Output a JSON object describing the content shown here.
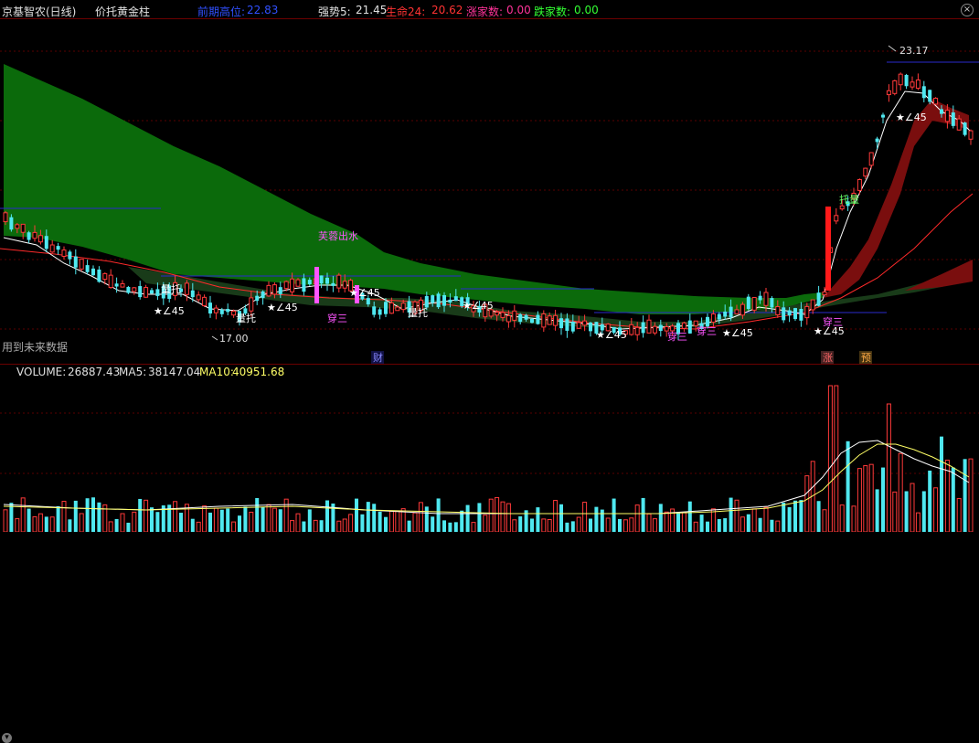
{
  "header": {
    "stock": "京基智农(日线)",
    "indicator": "价托黄金柱",
    "pressure_label": "前期高位:",
    "pressure_value": "22.83",
    "strong_label": "强势5:",
    "strong_value": "21.45",
    "life_label": "生命24:",
    "life_value": "20.62",
    "up_label": "涨家数:",
    "up_value": "0.00",
    "down_label": "跌家数:",
    "down_value": "0.00",
    "close_icon": "close-icon"
  },
  "main": {
    "high_label": "23.17",
    "low_label": "17.00",
    "future_note": "用到未来数据",
    "signals": {
      "star45": "★∠45",
      "liangtuo": "量托",
      "chuansan": "穿三",
      "furong": "芙蓉出水",
      "tuoliang": "托量"
    },
    "bottom_marks": {
      "cai": "财",
      "zhang": "涨",
      "yu": "预"
    }
  },
  "volume": {
    "label": "VOLUME:",
    "value": "26887.43",
    "ma5_label": "MA5:",
    "ma5_value": "38147.04",
    "ma10_label": "MA10:",
    "ma10_value": "40951.68",
    "menu_icon": "chevron-down-icon"
  },
  "colors": {
    "up": "#ff3a3a",
    "down": "#4fe8f0",
    "ma_white": "#ffffff",
    "ma_yellow": "#ffff66",
    "ma_red": "#ff2a2a",
    "ribbon_green": "#0a6e0a",
    "ribbon_red": "#8b1010",
    "pressure_blue": "#2a2acc",
    "signal_magenta": "#ff55ff",
    "signal_lime": "#66ff66"
  },
  "chart_data": {
    "type": "candlestick",
    "price_range": [
      16.5,
      24.0
    ],
    "max_price": 23.17,
    "min_price": 17.0,
    "volume_labels": {
      "volume": 26887.43,
      "ma5": 38147.04,
      "ma10": 40951.68
    }
  }
}
